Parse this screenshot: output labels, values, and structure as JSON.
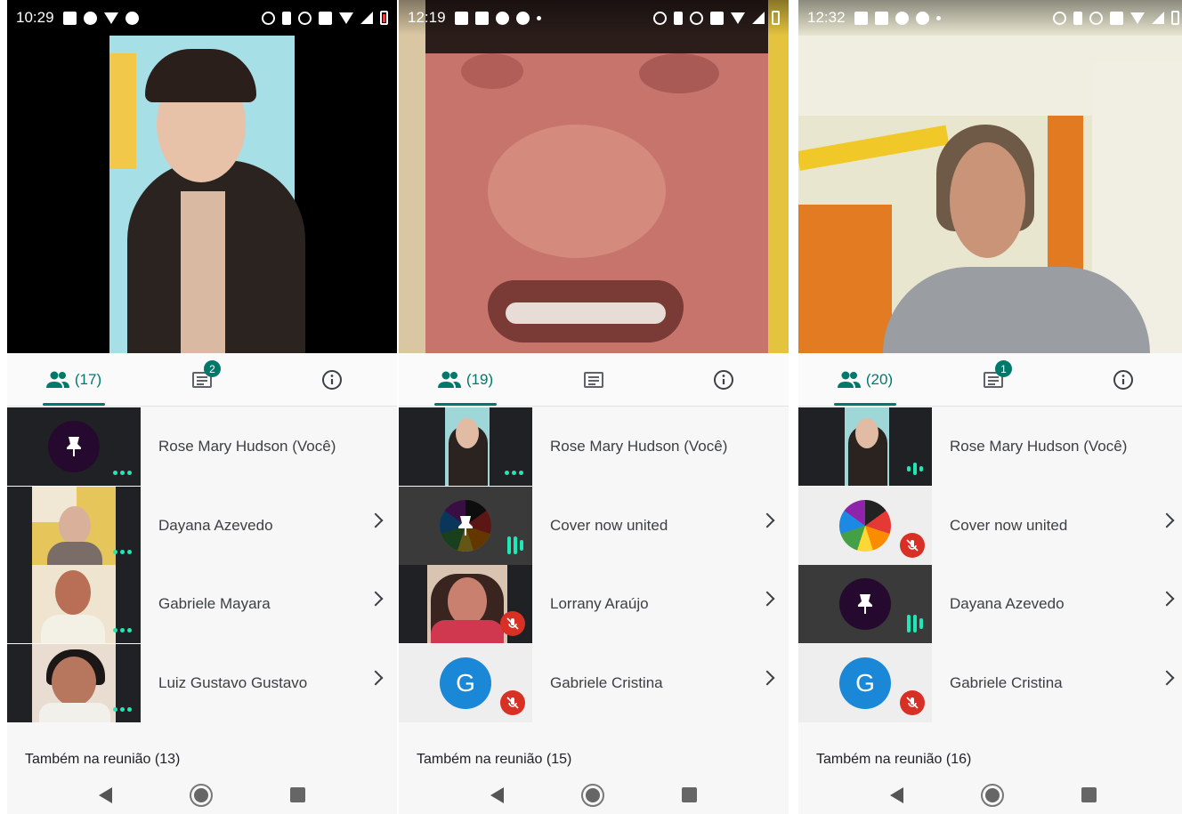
{
  "screens": [
    {
      "status_time": "10:29",
      "people_count": "(17)",
      "chat_badge": "2",
      "participants": [
        {
          "name": "Rose Mary Hudson (Você)"
        },
        {
          "name": "Dayana Azevedo"
        },
        {
          "name": "Gabriele Mayara"
        },
        {
          "name": "Luiz Gustavo Gustavo"
        }
      ],
      "also_in_meeting": "Também na reunião (13)"
    },
    {
      "status_time": "12:19",
      "people_count": "(19)",
      "chat_badge": "",
      "participants": [
        {
          "name": "Rose Mary Hudson (Você)"
        },
        {
          "name": "Cover now united"
        },
        {
          "name": "Lorrany Araújo"
        },
        {
          "name": "Gabriele Cristina",
          "avatar_letter": "G"
        }
      ],
      "also_in_meeting": "Também na reunião (15)"
    },
    {
      "status_time": "12:32",
      "people_count": "(20)",
      "chat_badge": "1",
      "participants": [
        {
          "name": "Rose Mary Hudson (Você)"
        },
        {
          "name": "Cover now united"
        },
        {
          "name": "Dayana Azevedo"
        },
        {
          "name": "Gabriele Cristina",
          "avatar_letter": "G"
        }
      ],
      "also_in_meeting": "Também na reunião (16)"
    }
  ],
  "colors": {
    "accent": "#00796b",
    "speaking": "#1de9b6",
    "muted": "#d93025",
    "avatar_blue": "#1a88d6"
  },
  "icons": [
    "people-icon",
    "chat-icon",
    "info-icon",
    "pin-icon",
    "mic-off-icon",
    "chevron-right-icon",
    "nav-back-icon",
    "nav-home-icon",
    "nav-recents-icon"
  ]
}
